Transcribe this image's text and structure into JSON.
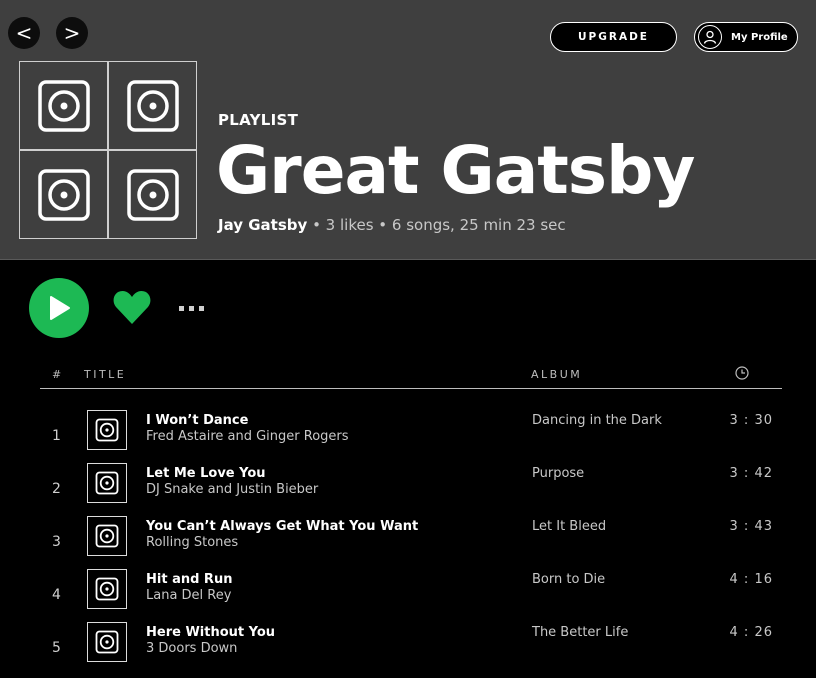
{
  "nav": {
    "back_label": "<",
    "forward_label": ">"
  },
  "header": {
    "upgrade_label": "UPGRADE",
    "profile_label": "My Profile",
    "profile_icon": "user-icon",
    "cover_icon": "speaker-icon",
    "type_label": "PLAYLIST",
    "title": "Great Gatsby",
    "owner": "Jay Gatsby",
    "stats": " • 3 likes • 6 songs, 25 min 23 sec"
  },
  "actions": {
    "play_icon": "play-icon",
    "like_icon": "heart-icon",
    "more_icon": "more-icon"
  },
  "colors": {
    "accent": "#1db954",
    "header_bg": "#3f3f3f",
    "background": "#000000"
  },
  "table": {
    "headers": {
      "num": "#",
      "title": "TITLE",
      "album": "ALBUM",
      "duration_icon": "clock-icon"
    },
    "rows": [
      {
        "num": "1",
        "title": "I Won’t Dance",
        "artist": "Fred Astaire and Ginger Rogers",
        "album": "Dancing in the Dark",
        "duration": "3 : 30"
      },
      {
        "num": "2",
        "title": "Let Me Love You",
        "artist": "DJ Snake and Justin Bieber",
        "album": "Purpose",
        "duration": "3 : 42"
      },
      {
        "num": "3",
        "title": "You Can’t Always Get What You Want",
        "artist": "Rolling Stones",
        "album": "Let It Bleed",
        "duration": "3 : 43"
      },
      {
        "num": "4",
        "title": "Hit and Run",
        "artist": "Lana Del Rey",
        "album": "Born to Die",
        "duration": "4 : 16"
      },
      {
        "num": "5",
        "title": "Here Without You",
        "artist": "3 Doors Down",
        "album": "The Better Life",
        "duration": "4 : 26"
      }
    ]
  }
}
